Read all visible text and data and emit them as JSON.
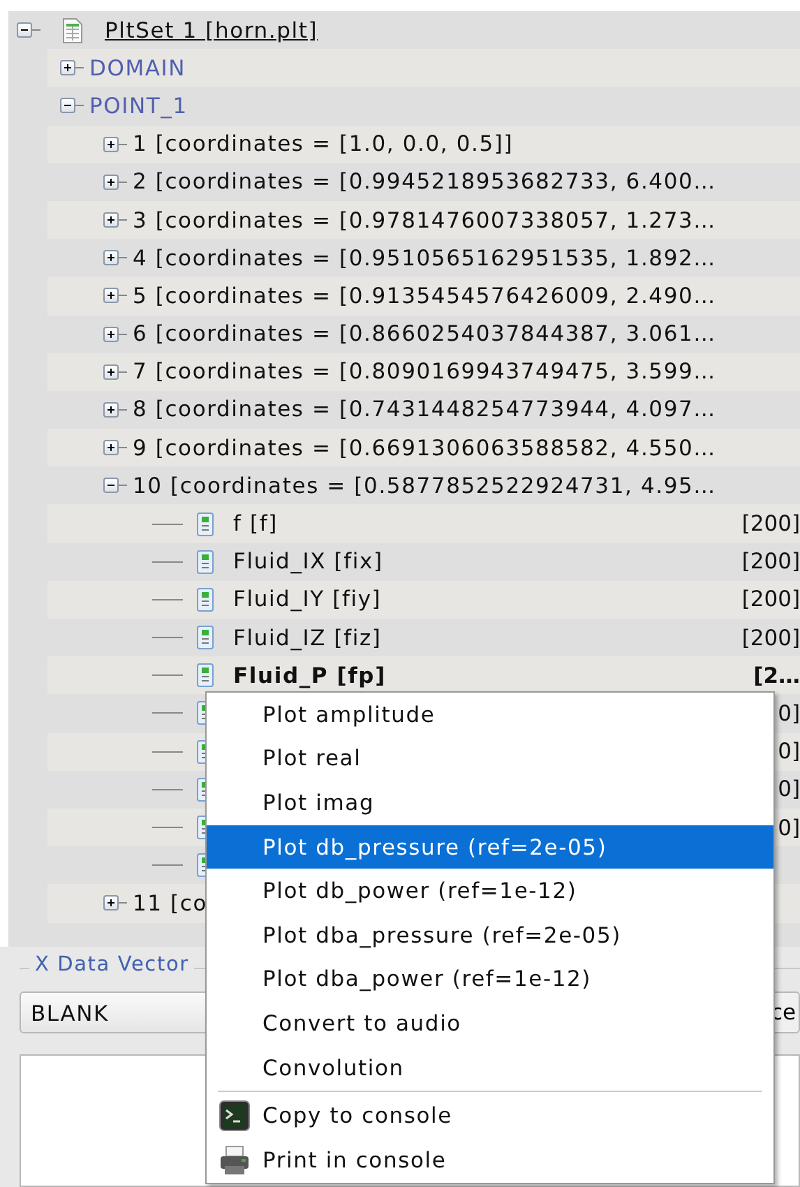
{
  "tree": {
    "label": "PltSet 1 [horn.plt]",
    "expanded": true,
    "children": [
      {
        "label": "DOMAIN",
        "expanded": false
      },
      {
        "label": "POINT_1",
        "expanded": true,
        "children": [
          {
            "label": "1 [coordinates = [1.0, 0.0, 0.5]]",
            "expanded": false
          },
          {
            "label": "2 [coordinates = [0.9945218953682733, 6.400…",
            "expanded": false
          },
          {
            "label": "3 [coordinates = [0.9781476007338057, 1.273…",
            "expanded": false
          },
          {
            "label": "4 [coordinates = [0.9510565162951535, 1.892…",
            "expanded": false
          },
          {
            "label": "5 [coordinates = [0.9135454576426009, 2.490…",
            "expanded": false
          },
          {
            "label": "6 [coordinates = [0.8660254037844387, 3.061…",
            "expanded": false
          },
          {
            "label": "7 [coordinates = [0.8090169943749475, 3.599…",
            "expanded": false
          },
          {
            "label": "8 [coordinates = [0.7431448254773944, 4.097…",
            "expanded": false
          },
          {
            "label": "9 [coordinates = [0.6691306063588582, 4.550…",
            "expanded": false
          },
          {
            "label": "10 [coordinates = [0.5877852522924731, 4.95…",
            "expanded": true,
            "children": [
              {
                "kind": "vector",
                "label": "f  [f]",
                "value": "[200]",
                "selected": false
              },
              {
                "kind": "vector",
                "label": "Fluid_IX  [fix]",
                "value": "[200]",
                "selected": false
              },
              {
                "kind": "vector",
                "label": "Fluid_IY  [fiy]",
                "value": "[200]",
                "selected": false
              },
              {
                "kind": "vector",
                "label": "Fluid_IZ  [fiz]",
                "value": "[200]",
                "selected": false
              },
              {
                "kind": "vector",
                "label": "Fluid_P  [fp]",
                "value": "[2…",
                "selected": true
              },
              {
                "kind": "vector",
                "value": "0]"
              },
              {
                "kind": "vector",
                "value": "0]"
              },
              {
                "kind": "vector",
                "value": "0]"
              },
              {
                "kind": "vector",
                "value": "0]"
              },
              {
                "kind": "vector"
              }
            ]
          },
          {
            "label": "11 [co",
            "expanded": false
          }
        ]
      }
    ]
  },
  "lower_panel": {
    "group_title": "X Data Vector",
    "combo_value": "BLANK",
    "button_label": "ce"
  },
  "context_menu": {
    "sections": [
      {
        "items": [
          {
            "label": "Plot amplitude",
            "selected": false
          },
          {
            "label": "Plot real",
            "selected": false
          },
          {
            "label": "Plot imag",
            "selected": false
          },
          {
            "label": "Plot db_pressure (ref=2e-05)",
            "selected": true
          },
          {
            "label": "Plot db_power (ref=1e-12)",
            "selected": false
          },
          {
            "label": "Plot dba_pressure (ref=2e-05)",
            "selected": false
          },
          {
            "label": "Plot dba_power (ref=1e-12)",
            "selected": false
          },
          {
            "label": "Convert to audio",
            "selected": false
          },
          {
            "label": "Convolution",
            "selected": false
          }
        ]
      },
      {
        "items": [
          {
            "label": "Copy to console",
            "kind": "terminal",
            "selected": false
          },
          {
            "label": "Print in console",
            "kind": "printer",
            "selected": false
          }
        ]
      }
    ]
  }
}
